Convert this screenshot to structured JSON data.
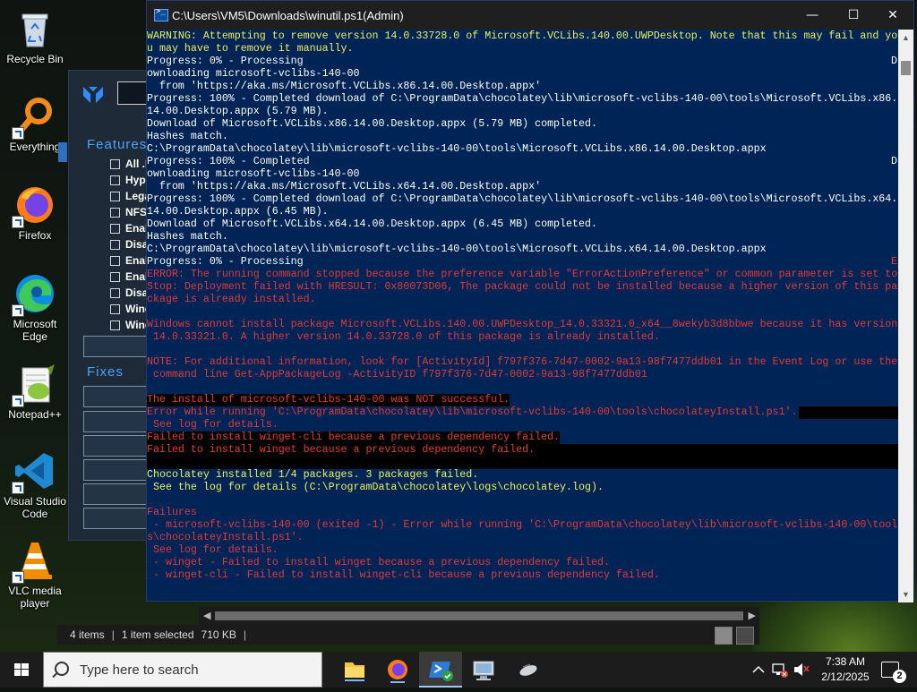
{
  "desktop": {
    "icons": [
      {
        "label": "Recycle Bin"
      },
      {
        "label": "Everything"
      },
      {
        "label": "Firefox"
      },
      {
        "label": "Microsoft Edge"
      },
      {
        "label": "Notepad++"
      },
      {
        "label": "Visual Studio Code"
      },
      {
        "label": "VLC media player"
      }
    ]
  },
  "winutil": {
    "features_heading": "Features",
    "fixes_heading": "Fixes",
    "feature_items": [
      "All .N",
      "Hype",
      "Lega",
      "NFS",
      "Enal",
      "Disa",
      "Enal",
      "Enal",
      "Disa",
      "Wind",
      "Wind"
    ]
  },
  "console": {
    "title": "C:\\Users\\VM5\\Downloads\\winutil.ps1(Admin)",
    "colors": {
      "background": "#012456",
      "warning": "#f0f05a",
      "error": "#e33a3a",
      "normal": "#ffffff"
    },
    "lines": {
      "l1": "WARNING: Attempting to remove version 14.0.33728.0 of Microsoft.VCLibs.140.00.UWPDesktop. Note that this may fail and yo",
      "l2": "u may have to remove it manually.",
      "l3": "Progress: 0% - Processing",
      "l4": "ownloading microsoft-vclibs-140-00",
      "l5": "  from 'https://aka.ms/Microsoft.VCLibs.x86.14.00.Desktop.appx'",
      "l6": "Progress: 100% - Completed download of C:\\ProgramData\\chocolatey\\lib\\microsoft-vclibs-140-00\\tools\\Microsoft.VCLibs.x86.",
      "l7": "14.00.Desktop.appx (5.79 MB).",
      "l8": "Download of Microsoft.VCLibs.x86.14.00.Desktop.appx (5.79 MB) completed.",
      "l9": "Hashes match.",
      "l10": "C:\\ProgramData\\chocolatey\\lib\\microsoft-vclibs-140-00\\tools\\Microsoft.VCLibs.x86.14.00.Desktop.appx",
      "l11": "Progress: 100% - Completed",
      "l12": "ownloading microsoft-vclibs-140-00",
      "l13": "  from 'https://aka.ms/Microsoft.VCLibs.x64.14.00.Desktop.appx'",
      "l14": "Progress: 100% - Completed download of C:\\ProgramData\\chocolatey\\lib\\microsoft-vclibs-140-00\\tools\\Microsoft.VCLibs.x64.",
      "l15": "14.00.Desktop.appx (6.45 MB).",
      "l16": "Download of Microsoft.VCLibs.x64.14.00.Desktop.appx (6.45 MB) completed.",
      "l17": "Hashes match.",
      "l18": "C:\\ProgramData\\chocolatey\\lib\\microsoft-vclibs-140-00\\tools\\Microsoft.VCLibs.x64.14.00.Desktop.appx",
      "l19": "Progress: 0% - Processing",
      "l20": "ERROR: The running command stopped because the preference variable \"ErrorActionPreference\" or common parameter is set to",
      "l21": "Stop: Deployment failed with HRESULT: 0x80073D06, The package could not be installed because a higher version of this pa",
      "l22": "ckage is already installed.",
      "l24": "Windows cannot install package Microsoft.VCLibs.140.00.UWPDesktop_14.0.33321.0_x64__8wekyb3d8bbwe because it has version",
      "l25": " 14.0.33321.0. A higher version 14.0.33728.0 of this package is already installed.",
      "l27": "NOTE: For additional information, look for [ActivityId] f797f376-7d47-0002-9a13-98f7477ddb01 in the Event Log or use the",
      "l28": " command line Get-AppPackageLog -ActivityID f797f376-7d47-0002-9a13-98f7477ddb01",
      "l30": "The install of microsoft-vclibs-140-00 was NOT successful.",
      "l31": "Error while running 'C:\\ProgramData\\chocolatey\\lib\\microsoft-vclibs-140-00\\tools\\chocolateyInstall.ps1'.",
      "l32": " See log for details.",
      "l33": "Failed to install winget-cli because a previous dependency failed.",
      "l34": "Failed to install winget because a previous dependency failed.",
      "l36": "Chocolatey installed 1/4 packages. 3 packages failed.",
      "l37": " See the log for details (C:\\ProgramData\\chocolatey\\logs\\chocolatey.log).",
      "l39": "Failures",
      "l40": " - microsoft-vclibs-140-00 (exited -1) - Error while running 'C:\\ProgramData\\chocolatey\\lib\\microsoft-vclibs-140-00\\tools",
      "l41": "s\\chocolateyInstall.ps1'.",
      "l42": " See log for details.",
      "l43": " - winget - Failed to install winget because a previous dependency failed.",
      "l44": " - winget-cli - Failed to install winget-cli because a previous dependency failed.",
      "side_d1": "D",
      "side_d2": "D",
      "side_e": "E"
    }
  },
  "explorer": {
    "status": {
      "items": "4 items",
      "selected": "1 item selected",
      "size": "710 KB"
    }
  },
  "taskbar": {
    "search_placeholder": "Type here to search",
    "time": "7:38 AM",
    "date": "2/12/2025",
    "notification_count": "2"
  }
}
